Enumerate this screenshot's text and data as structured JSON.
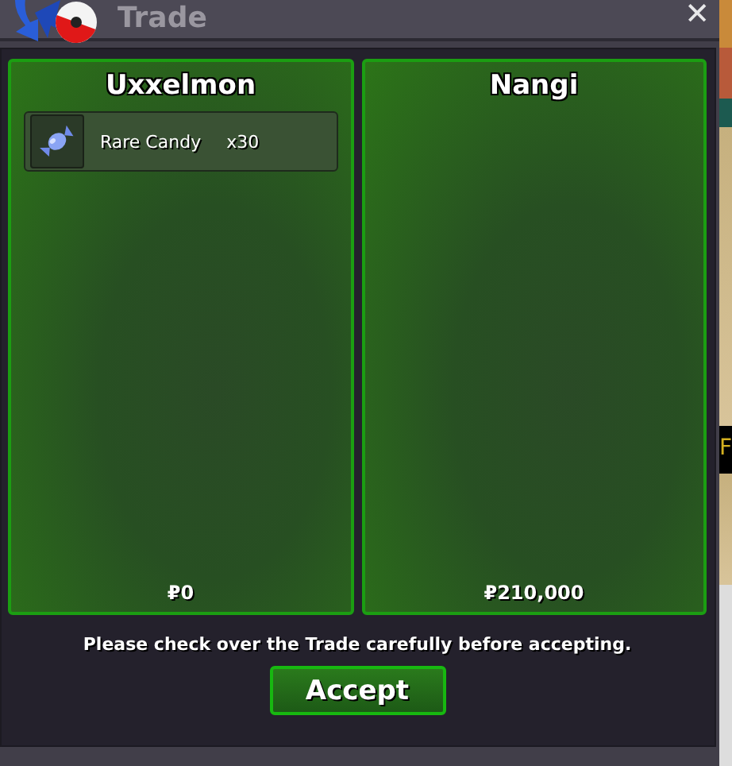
{
  "window": {
    "title": "Trade",
    "close": "✕"
  },
  "panels": [
    {
      "trainer": "Uxxelmon",
      "items": [
        {
          "name": "Rare Candy",
          "quantity": "x30"
        }
      ],
      "money": "0"
    },
    {
      "trainer": "Nangi",
      "money": "210,000"
    }
  ],
  "currency_symbol": "₽",
  "notice": "Please check over the Trade carefully before accepting.",
  "accept_button": "Accept",
  "background": {
    "label": "F"
  }
}
